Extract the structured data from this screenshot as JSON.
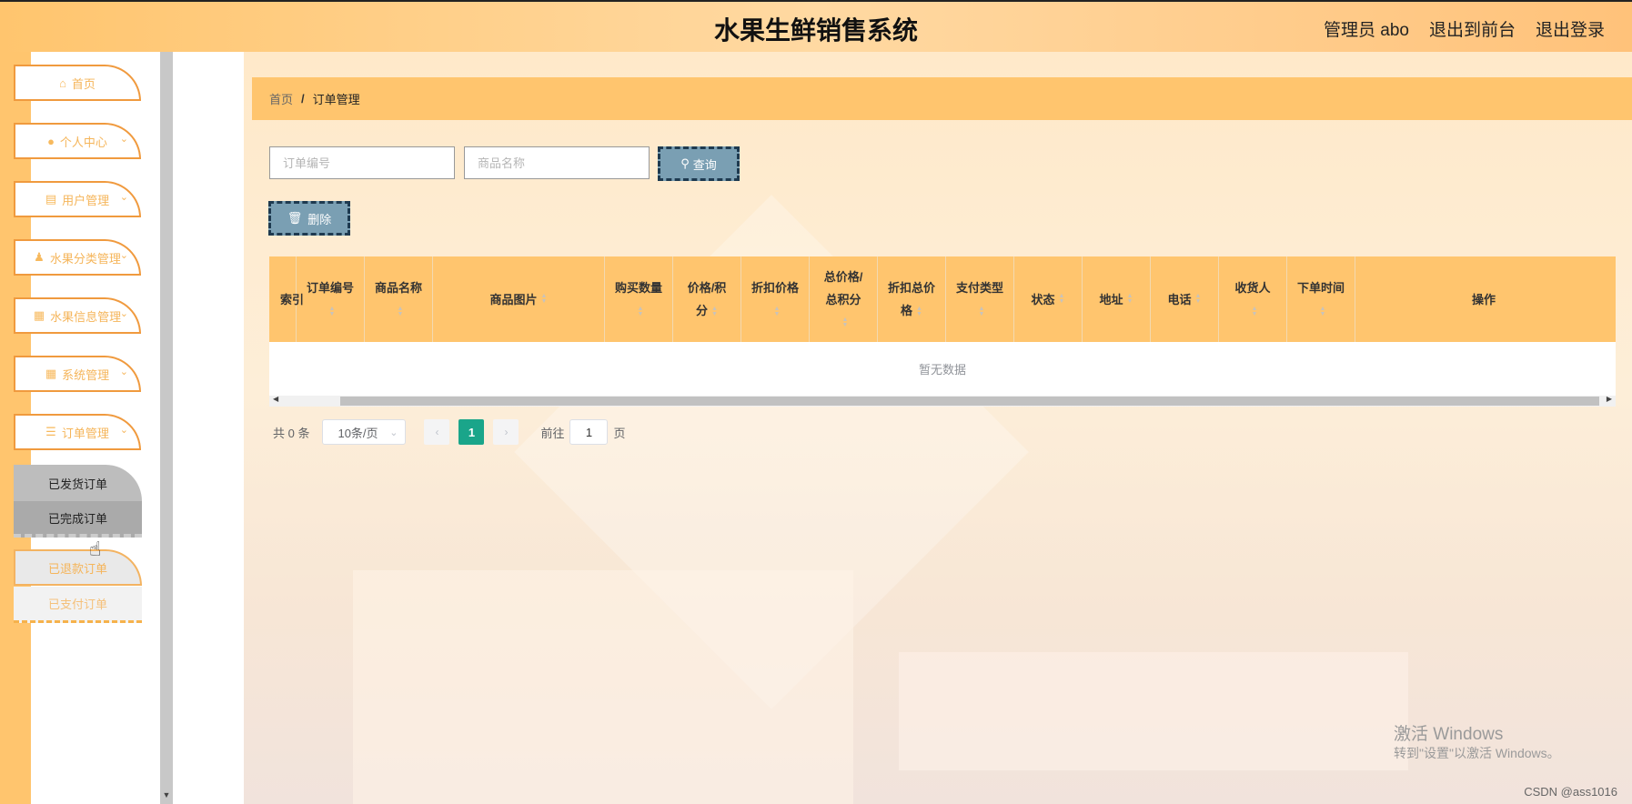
{
  "header": {
    "title": "水果生鲜销售系统",
    "admin_label": "管理员 abo",
    "to_front": "退出到前台",
    "logout": "退出登录"
  },
  "sidebar": {
    "items": [
      {
        "label": "首页",
        "icon": "home-icon",
        "has_arrow": false
      },
      {
        "label": "个人中心",
        "icon": "user-icon",
        "has_arrow": true
      },
      {
        "label": "用户管理",
        "icon": "table-icon",
        "has_arrow": true
      },
      {
        "label": "水果分类管理",
        "icon": "person-icon",
        "has_arrow": true
      },
      {
        "label": "水果信息管理",
        "icon": "grid-icon",
        "has_arrow": true
      },
      {
        "label": "系统管理",
        "icon": "grid-icon",
        "has_arrow": true
      },
      {
        "label": "订单管理",
        "icon": "list-icon",
        "has_arrow": true
      }
    ],
    "submenu": [
      {
        "label": "已发货订单"
      },
      {
        "label": "已完成订单"
      },
      {
        "label": "已退款订单"
      },
      {
        "label": "已支付订单"
      }
    ]
  },
  "breadcrumb": {
    "home": "首页",
    "separator": "/",
    "current": "订单管理"
  },
  "search": {
    "order_no_placeholder": "订单编号",
    "goods_name_placeholder": "商品名称",
    "query_label": "查询",
    "delete_label": "删除"
  },
  "table": {
    "columns": [
      {
        "label": "索引",
        "sortable": false
      },
      {
        "label": "订单编号",
        "sortable": true
      },
      {
        "label": "商品名称",
        "sortable": true
      },
      {
        "label": "商品图片",
        "sortable": true
      },
      {
        "label": "购买数量",
        "sortable": true
      },
      {
        "label": "价格/积分",
        "sortable": true
      },
      {
        "label": "折扣价格",
        "sortable": true
      },
      {
        "label": "总价格/总积分",
        "sortable": true
      },
      {
        "label": "折扣总价格",
        "sortable": true
      },
      {
        "label": "支付类型",
        "sortable": true
      },
      {
        "label": "状态",
        "sortable": true
      },
      {
        "label": "地址",
        "sortable": true
      },
      {
        "label": "电话",
        "sortable": true
      },
      {
        "label": "收货人",
        "sortable": true
      },
      {
        "label": "下单时间",
        "sortable": true
      },
      {
        "label": "操作",
        "sortable": false
      }
    ],
    "empty_text": "暂无数据"
  },
  "pagination": {
    "total": "共 0 条",
    "page_size": "10条/页",
    "current_page": "1",
    "goto_label": "前往",
    "goto_value": "1",
    "page_unit": "页"
  },
  "watermark": {
    "line1": "激活 Windows",
    "line2": "转到\"设置\"以激活 Windows。",
    "csdn": "CSDN @ass1016"
  },
  "colors": {
    "accent": "#ffc56e",
    "menu_border": "#f09a3e",
    "button": "#7a9fb3",
    "page_active": "#1aa58a"
  }
}
